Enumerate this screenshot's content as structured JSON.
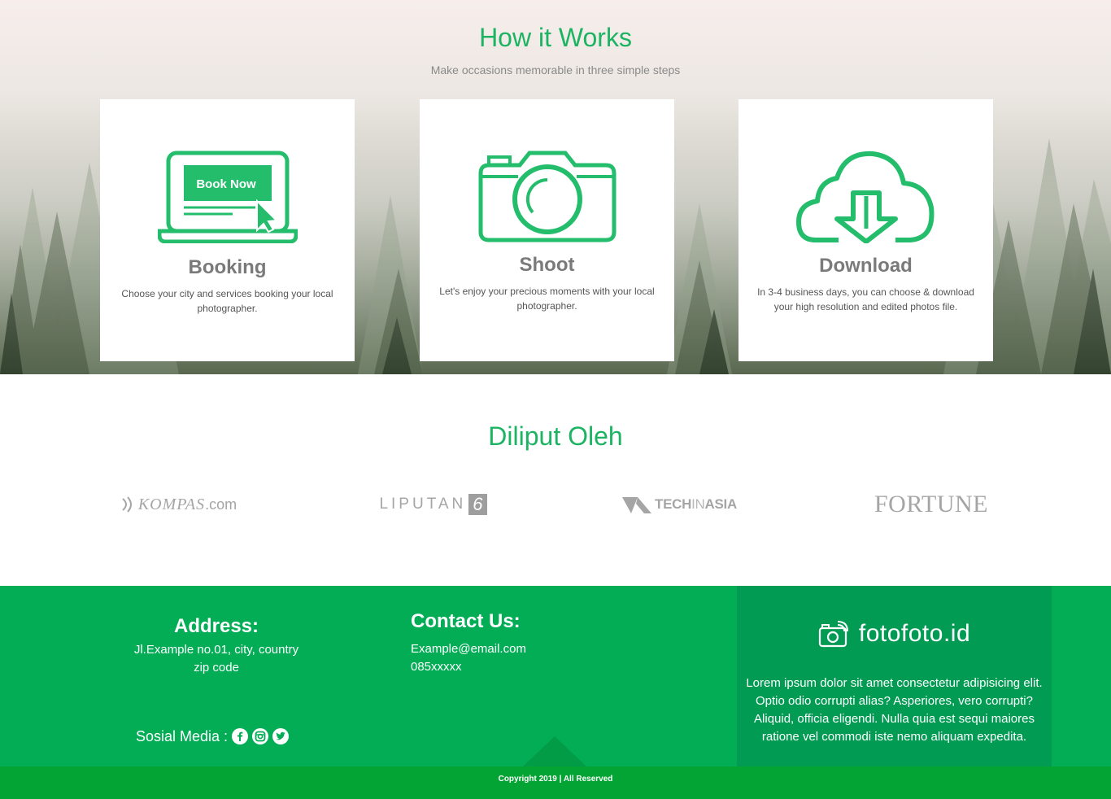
{
  "how_it_works": {
    "title": "How it Works",
    "subtitle": "Make occasions memorable in three simple steps",
    "cards": [
      {
        "icon": "laptop-book-now-icon",
        "icon_label": "Book Now",
        "title": "Booking",
        "text": "Choose your city and services booking your local photographer."
      },
      {
        "icon": "camera-icon",
        "title": "Shoot",
        "text": "Let's enjoy your precious moments with your local photographer."
      },
      {
        "icon": "cloud-download-icon",
        "title": "Download",
        "text": "In 3-4 business days, you can choose & download your high resolution and edited photos file."
      }
    ]
  },
  "covered_by": {
    "title": "Diliput Oleh",
    "logos": [
      {
        "name": "KOMPAS.com",
        "main": "KOMPAS",
        "suffix": ".com"
      },
      {
        "name": "LIPUTAN 6",
        "main": "LIPUTAN",
        "suffix": "6"
      },
      {
        "name": "TECHINASIA",
        "main": "TECH",
        "mid": "IN",
        "suffix": "ASIA"
      },
      {
        "name": "FORTUNE",
        "main": "FORTUNE"
      }
    ]
  },
  "footer": {
    "address": {
      "title": "Address:",
      "line1": "Jl.Example no.01, city, country",
      "line2": "zip code"
    },
    "social": {
      "label": "Sosial Media :",
      "icons": [
        "facebook-icon",
        "instagram-icon",
        "twitter-icon"
      ]
    },
    "contact": {
      "title": "Contact Us:",
      "email": "Example@email.com",
      "phone": "085xxxxx"
    },
    "brand": {
      "name": "fotofoto.id",
      "text": "Lorem ipsum dolor sit amet consectetur adipisicing elit. Optio odio corrupti alias? Asperiores, vero corrupti? Aliquid, officia eligendi. Nulla quia est sequi maiores ratione vel commodi iste nemo aliquam expedita."
    },
    "copyright": "Copyright 2019 | All Reserved"
  },
  "colors": {
    "accent_green": "#1cb463",
    "footer_green": "#02ad55",
    "brand_panel": "#029b53",
    "copyright_bar": "#03a433",
    "heading_grey": "#7a7a7a"
  }
}
